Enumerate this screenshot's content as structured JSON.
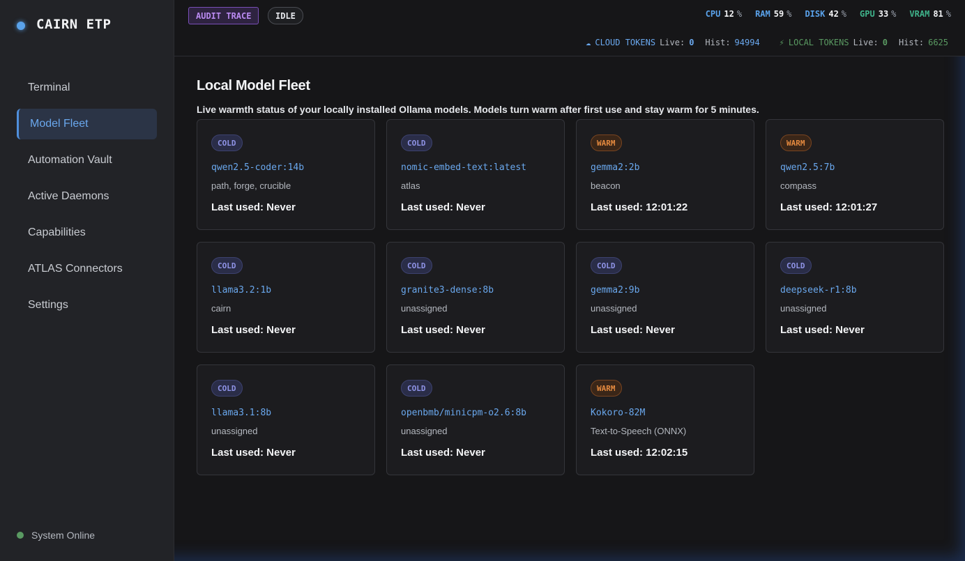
{
  "brand": {
    "name": "CAIRN ETP"
  },
  "sidebar": {
    "items": [
      {
        "label": "Terminal",
        "active": false
      },
      {
        "label": "Model Fleet",
        "active": true
      },
      {
        "label": "Automation Vault",
        "active": false
      },
      {
        "label": "Active Daemons",
        "active": false
      },
      {
        "label": "Capabilities",
        "active": false
      },
      {
        "label": "ATLAS Connectors",
        "active": false
      },
      {
        "label": "Settings",
        "active": false
      }
    ],
    "status": "System Online"
  },
  "topbar": {
    "audit_label": "AUDIT TRACE",
    "state_label": "IDLE",
    "metrics": [
      {
        "label": "CPU",
        "value": "12",
        "unit": "%",
        "color": "#5aa2ea"
      },
      {
        "label": "RAM",
        "value": "59",
        "unit": "%",
        "color": "#5aa2ea"
      },
      {
        "label": "DISK",
        "value": "42",
        "unit": "%",
        "color": "#5aa2ea"
      },
      {
        "label": "GPU",
        "value": "33",
        "unit": "%",
        "color": "#3fb28a"
      },
      {
        "label": "VRAM",
        "value": "81",
        "unit": "%",
        "color": "#3fb28a"
      }
    ],
    "tokens": {
      "cloud": {
        "icon": "cloud-icon",
        "label": "CLOUD TOKENS",
        "live_key": "Live:",
        "live": "0",
        "hist_key": "Hist:",
        "hist": "94994",
        "color": "#6aa8ee"
      },
      "local": {
        "icon": "lightning-icon",
        "label": "LOCAL TOKENS",
        "live_key": "Live:",
        "live": "0",
        "hist_key": "Hist:",
        "hist": "6625",
        "color": "#5a9a62"
      }
    }
  },
  "main": {
    "title": "Local Model Fleet",
    "subtitle": "Live warmth status of your locally installed Ollama models. Models turn warm after first use and stay warm for 5 minutes.",
    "models": [
      {
        "status": "COLD",
        "name": "qwen2.5-coder:14b",
        "role": "path, forge, crucible",
        "last_used": "Last used: Never"
      },
      {
        "status": "COLD",
        "name": "nomic-embed-text:latest",
        "role": "atlas",
        "last_used": "Last used: Never"
      },
      {
        "status": "WARM",
        "name": "gemma2:2b",
        "role": "beacon",
        "last_used": "Last used: 12:01:22"
      },
      {
        "status": "WARM",
        "name": "qwen2.5:7b",
        "role": "compass",
        "last_used": "Last used: 12:01:27"
      },
      {
        "status": "COLD",
        "name": "llama3.2:1b",
        "role": "cairn",
        "last_used": "Last used: Never"
      },
      {
        "status": "COLD",
        "name": "granite3-dense:8b",
        "role": "unassigned",
        "last_used": "Last used: Never"
      },
      {
        "status": "COLD",
        "name": "gemma2:9b",
        "role": "unassigned",
        "last_used": "Last used: Never"
      },
      {
        "status": "COLD",
        "name": "deepseek-r1:8b",
        "role": "unassigned",
        "last_used": "Last used: Never"
      },
      {
        "status": "COLD",
        "name": "llama3.1:8b",
        "role": "unassigned",
        "last_used": "Last used: Never"
      },
      {
        "status": "COLD",
        "name": "openbmb/minicpm-o2.6:8b",
        "role": "unassigned",
        "last_used": "Last used: Never"
      },
      {
        "status": "WARM",
        "name": "Kokoro-82M",
        "role": "Text-to-Speech (ONNX)",
        "last_used": "Last used: 12:02:15"
      }
    ]
  }
}
